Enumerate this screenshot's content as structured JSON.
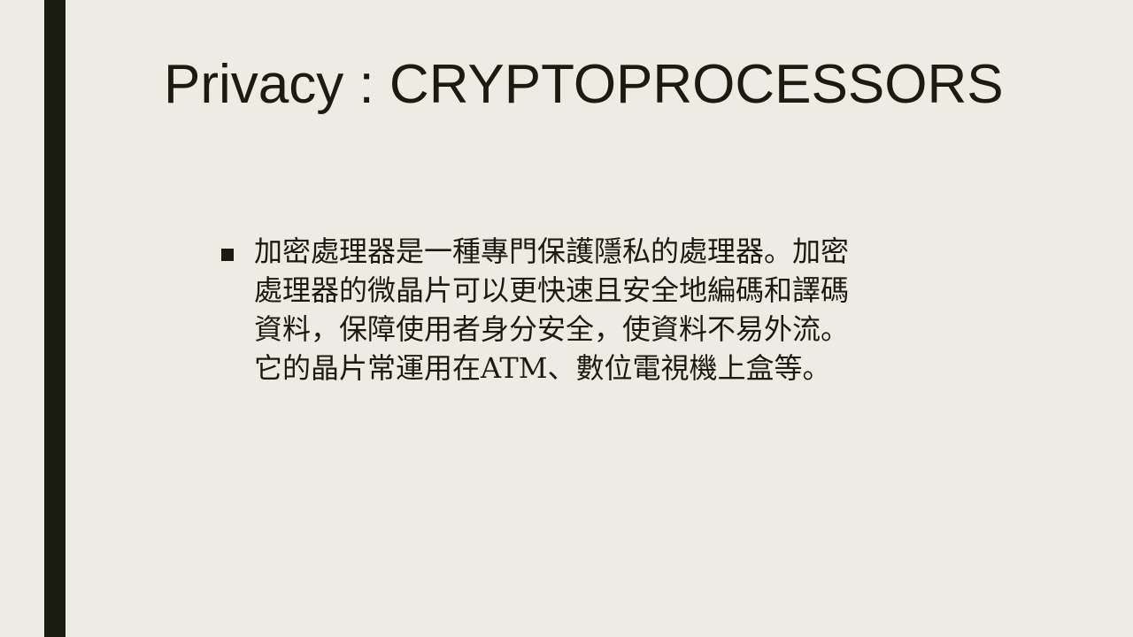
{
  "slide": {
    "title": "Privacy : CRYPTOPROCESSORS",
    "bullets": [
      {
        "lines": [
          "加密處理器是一種專門保護隱私的處理器。加密",
          "處理器的微晶片可以更快速且安全地編碼和譯碼",
          "資料，保障使用者身分安全，使資料不易外流。",
          "它的晶片常運用在ATM、數位電視機上盒等。"
        ]
      }
    ]
  },
  "colors": {
    "background": "#EEEBE4",
    "accent_bar": "#1A1C12",
    "text": "#1A1C12"
  },
  "icons": {
    "bullet": "square-bullet-icon"
  }
}
